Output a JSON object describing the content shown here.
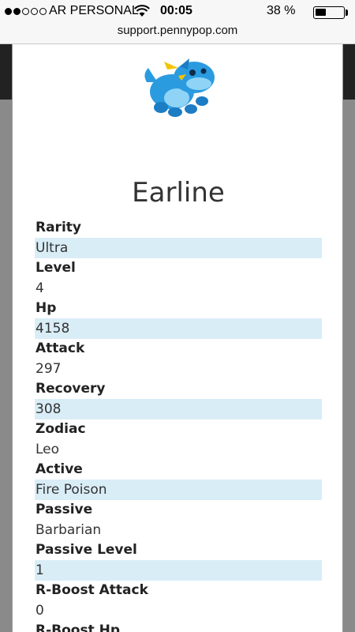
{
  "status_bar": {
    "carrier": "AR PERSONAL",
    "time": "00:05",
    "battery": "38 %",
    "battery_level": 0.38,
    "signal_bars_filled": 2,
    "signal_bars_total": 5
  },
  "browser": {
    "url": "support.pennypop.com"
  },
  "monster": {
    "name": "Earline",
    "image_icon": "blue-creature-icon"
  },
  "stats": [
    {
      "label": "Rarity",
      "value": "Ultra"
    },
    {
      "label": "Level",
      "value": "4"
    },
    {
      "label": "Hp",
      "value": "4158"
    },
    {
      "label": "Attack",
      "value": "297"
    },
    {
      "label": "Recovery",
      "value": "308"
    },
    {
      "label": "Zodiac",
      "value": "Leo"
    },
    {
      "label": "Active",
      "value": "Fire Poison"
    },
    {
      "label": "Passive",
      "value": "Barbarian"
    },
    {
      "label": "Passive Level",
      "value": "1"
    },
    {
      "label": "R-Boost Attack",
      "value": "0"
    },
    {
      "label": "R-Boost Hp",
      "value": ""
    }
  ],
  "colors": {
    "shaded_row": "#d9edf7",
    "creature_blue": "#2b9be0",
    "creature_yellow": "#f5c400"
  }
}
